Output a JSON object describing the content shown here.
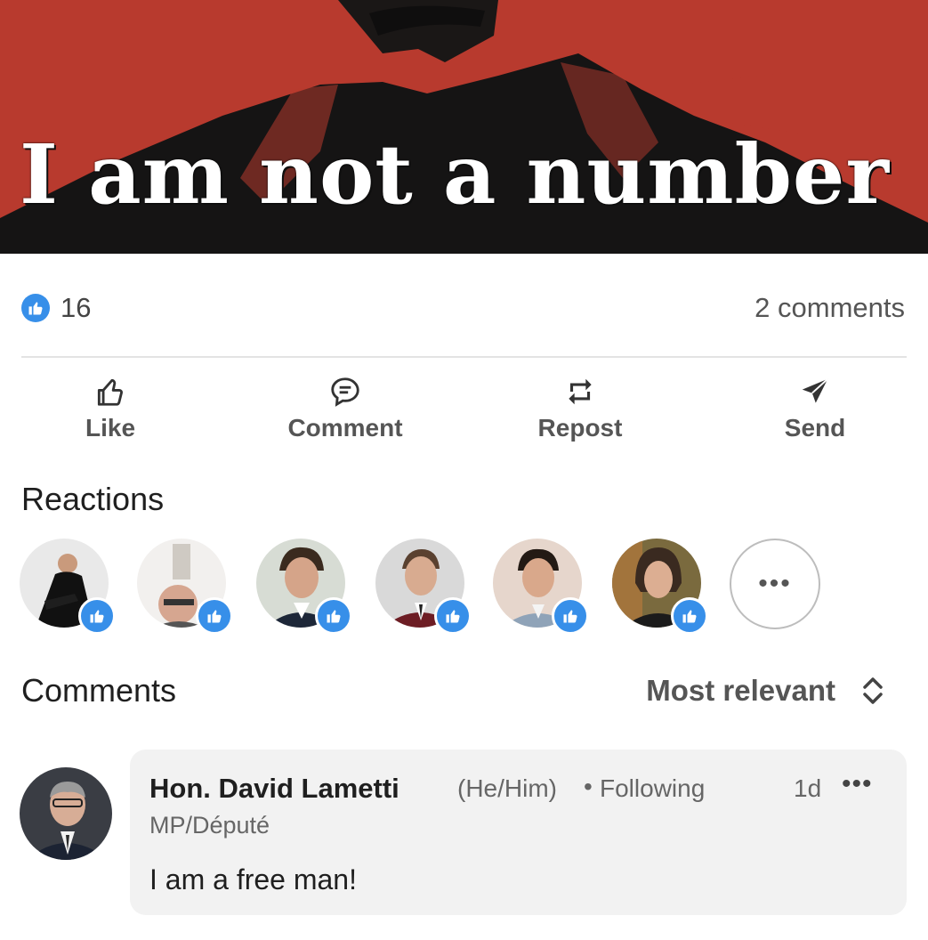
{
  "post": {
    "image_caption": "I am not a number",
    "colors": {
      "image_red": "#b83a2e",
      "image_dark": "#151414",
      "linkedin_blue": "#378fe9"
    }
  },
  "social": {
    "likes_count": "16",
    "comments_count": "2 comments"
  },
  "actions": [
    {
      "label": "Like",
      "icon": "thumbs-up-outline-icon"
    },
    {
      "label": "Comment",
      "icon": "speech-bubble-icon"
    },
    {
      "label": "Repost",
      "icon": "repost-arrows-icon"
    },
    {
      "label": "Send",
      "icon": "paper-plane-icon"
    }
  ],
  "reactions": {
    "title": "Reactions",
    "reactors": [
      {
        "icon": "avatar",
        "reaction": "like"
      },
      {
        "icon": "avatar",
        "reaction": "like"
      },
      {
        "icon": "avatar",
        "reaction": "like"
      },
      {
        "icon": "avatar",
        "reaction": "like"
      },
      {
        "icon": "avatar",
        "reaction": "like"
      },
      {
        "icon": "avatar",
        "reaction": "like"
      }
    ],
    "more_label": "•••"
  },
  "comments": {
    "title": "Comments",
    "sort_label": "Most relevant",
    "items": [
      {
        "author": "Hon. David Lametti",
        "pronouns": "(He/Him)",
        "separator": "•",
        "follow_status": "Following",
        "headline": "MP/Député",
        "time": "1d",
        "more": "•••",
        "text": "I am a free man!"
      }
    ]
  }
}
